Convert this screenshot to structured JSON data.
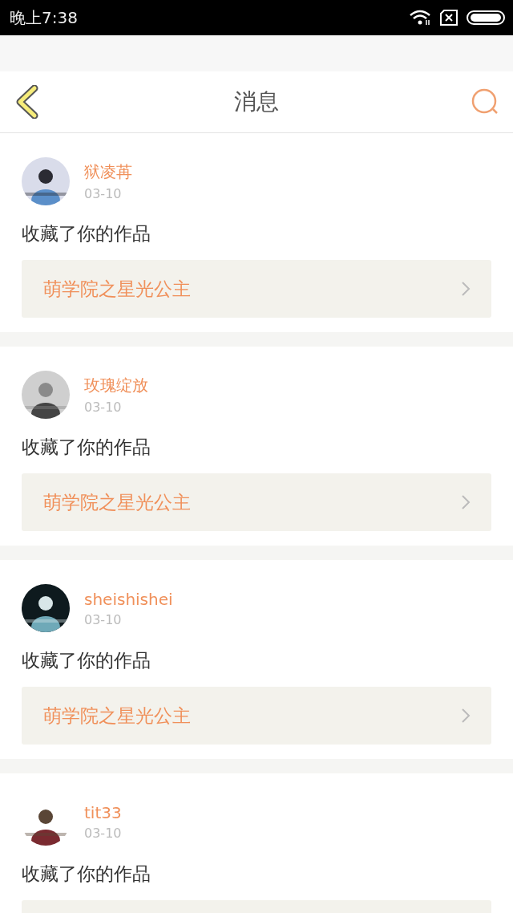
{
  "status_bar": {
    "time": "晚上7:38"
  },
  "header": {
    "title": "消息"
  },
  "messages": [
    {
      "name": "狱凌苒",
      "date": "03-10",
      "action": "收藏了你的作品",
      "work": "萌学院之星光公主"
    },
    {
      "name": "玫瑰绽放",
      "date": "03-10",
      "action": "收藏了你的作品",
      "work": "萌学院之星光公主"
    },
    {
      "name": "sheishishei",
      "date": "03-10",
      "action": "收藏了你的作品",
      "work": "萌学院之星光公主"
    },
    {
      "name": "tit33",
      "date": "03-10",
      "action": "收藏了你的作品",
      "work_cut": true
    }
  ]
}
